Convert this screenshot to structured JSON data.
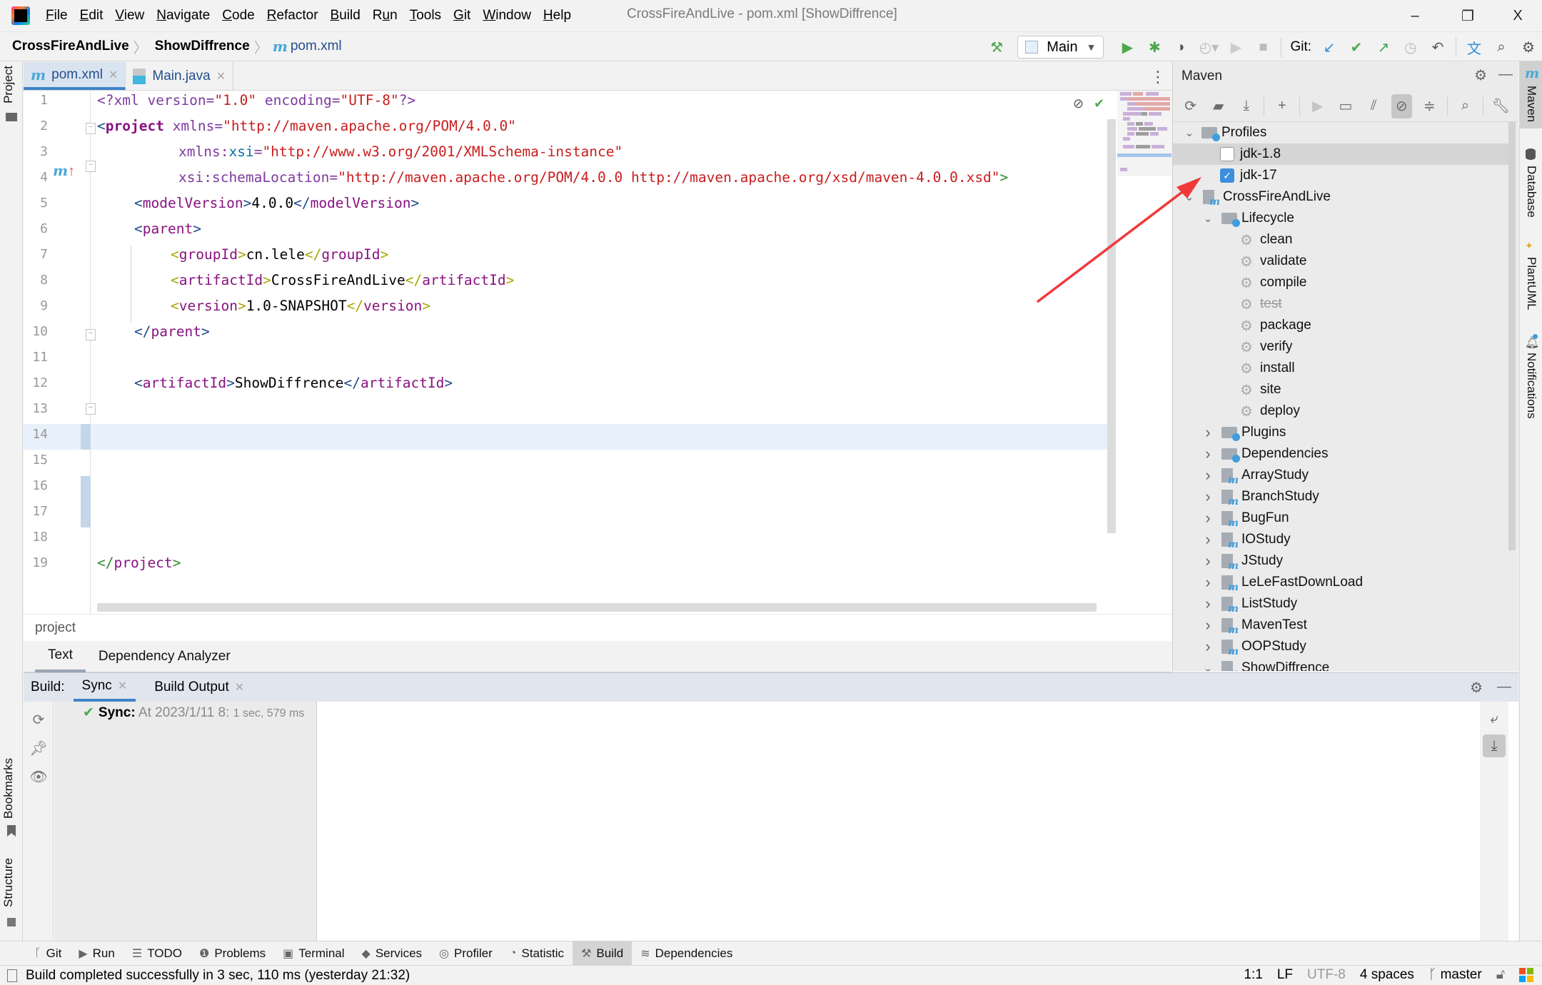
{
  "window": {
    "title": "CrossFireAndLive - pom.xml [ShowDiffrence]",
    "minimize_glyph": "–",
    "restore_glyph": "❐",
    "close_glyph": "X"
  },
  "menu": [
    {
      "mnemonic": "F",
      "rest": "ile"
    },
    {
      "mnemonic": "E",
      "rest": "dit"
    },
    {
      "mnemonic": "V",
      "rest": "iew"
    },
    {
      "mnemonic": "N",
      "rest": "avigate"
    },
    {
      "mnemonic": "C",
      "rest": "ode"
    },
    {
      "mnemonic": "R",
      "rest": "efactor"
    },
    {
      "mnemonic": "B",
      "rest": "uild"
    },
    {
      "pre": "R",
      "mnemonic": "u",
      "rest": "n"
    },
    {
      "mnemonic": "T",
      "rest": "ools"
    },
    {
      "mnemonic": "G",
      "rest": "it"
    },
    {
      "mnemonic": "W",
      "rest": "indow"
    },
    {
      "mnemonic": "H",
      "rest": "elp"
    }
  ],
  "breadcrumb": {
    "project": "CrossFireAndLive",
    "module": "ShowDiffrence",
    "file_icon": "m",
    "file": "pom.xml"
  },
  "toolbar": {
    "run_config": "Main",
    "git_label": "Git:"
  },
  "left_stripe": {
    "project": "Project",
    "bookmarks": "Bookmarks",
    "structure": "Structure"
  },
  "right_stripe": {
    "maven": "Maven",
    "database": "Database",
    "plantuml": "PlantUML",
    "notifications": "Notifications"
  },
  "editor_tabs": [
    {
      "icon": "m",
      "label": "pom.xml",
      "active": true
    },
    {
      "icon": "java",
      "label": "Main.java",
      "active": false
    }
  ],
  "editor": {
    "line_numbers": [
      "1",
      "2",
      "3",
      "4",
      "5",
      "6",
      "7",
      "8",
      "9",
      "10",
      "11",
      "12",
      "13",
      "14",
      "15",
      "16",
      "17",
      "18",
      "19"
    ],
    "lines": {
      "l1": {
        "a": "<?xml ",
        "b": "version",
        "c": "=",
        "d": "\"1.0\"",
        "e": " ",
        "f": "encoding",
        "g": "=",
        "h": "\"UTF-8\"",
        "i": "?>"
      },
      "l2": {
        "a": "<",
        "b": "project",
        "c": " xmlns",
        "d": "=",
        "e": "\"http://maven.apache.org/POM/4.0.0\""
      },
      "l3": {
        "a": "xmlns:",
        "b": "xsi",
        "c": "=",
        "d": "\"http://www.w3.org/2001/XMLSchema-instance\""
      },
      "l4": {
        "a": "xsi:schemaLocation",
        "b": "=",
        "c": "\"http://maven.apache.org/POM/4.0.0 http://maven.apache.org/xsd/maven-4.0.0.xsd\"",
        "d": ">"
      },
      "l5": {
        "a": "<",
        "b": "modelVersion",
        "c": ">",
        "d": "4.0.0",
        "e": "</",
        "f": "modelVersion",
        "g": ">"
      },
      "l6": {
        "a": "<",
        "b": "parent",
        "c": ">"
      },
      "l7": {
        "a": "<",
        "b": "groupId",
        "c": ">",
        "d": "cn.lele",
        "e": "</",
        "f": "groupId",
        "g": ">"
      },
      "l8": {
        "a": "<",
        "b": "artifactId",
        "c": ">",
        "d": "CrossFireAndLive",
        "e": "</",
        "f": "artifactId",
        "g": ">"
      },
      "l9": {
        "a": "<",
        "b": "version",
        "c": ">",
        "d": "1.0-SNAPSHOT",
        "e": "</",
        "f": "version",
        "g": ">"
      },
      "l10": {
        "a": "</",
        "b": "parent",
        "c": ">"
      },
      "l12": {
        "a": "<",
        "b": "artifactId",
        "c": ">",
        "d": "ShowDiffrence",
        "e": "</",
        "f": "artifactId",
        "g": ">"
      },
      "l19": {
        "a": "</",
        "b": "project",
        "c": ">"
      }
    },
    "gutter_marker_line6": "m",
    "current_line": 14
  },
  "structure_path": "project",
  "bottom_editor_tabs": [
    {
      "label": "Text",
      "active": true
    },
    {
      "label": "Dependency Analyzer",
      "active": false
    }
  ],
  "maven": {
    "title": "Maven",
    "tree": [
      {
        "label": "Profiles",
        "level": 0,
        "type": "profiles-folder",
        "expanded": true
      },
      {
        "label": "jdk-1.8",
        "level": 1,
        "type": "checkbox",
        "checked": false,
        "selected": true
      },
      {
        "label": "jdk-17",
        "level": 1,
        "type": "checkbox",
        "checked": true
      },
      {
        "label": "CrossFireAndLive",
        "level": 0,
        "type": "module",
        "expanded": true
      },
      {
        "label": "Lifecycle",
        "level": 1,
        "type": "lifecycle-folder",
        "expanded": true
      },
      {
        "label": "clean",
        "level": 2,
        "type": "goal"
      },
      {
        "label": "validate",
        "level": 2,
        "type": "goal"
      },
      {
        "label": "compile",
        "level": 2,
        "type": "goal"
      },
      {
        "label": "test",
        "level": 2,
        "type": "goal",
        "skipped": true
      },
      {
        "label": "package",
        "level": 2,
        "type": "goal"
      },
      {
        "label": "verify",
        "level": 2,
        "type": "goal"
      },
      {
        "label": "install",
        "level": 2,
        "type": "goal"
      },
      {
        "label": "site",
        "level": 2,
        "type": "goal"
      },
      {
        "label": "deploy",
        "level": 2,
        "type": "goal"
      },
      {
        "label": "Plugins",
        "level": 1,
        "type": "plugins-folder",
        "expanded": false
      },
      {
        "label": "Dependencies",
        "level": 1,
        "type": "dependencies-folder",
        "expanded": false
      },
      {
        "label": "ArrayStudy",
        "level": 1,
        "type": "module",
        "expanded": false
      },
      {
        "label": "BranchStudy",
        "level": 1,
        "type": "module",
        "expanded": false
      },
      {
        "label": "BugFun",
        "level": 1,
        "type": "module",
        "expanded": false
      },
      {
        "label": "IOStudy",
        "level": 1,
        "type": "module",
        "expanded": false
      },
      {
        "label": "JStudy",
        "level": 1,
        "type": "module",
        "expanded": false
      },
      {
        "label": "LeLeFastDownLoad",
        "level": 1,
        "type": "module",
        "expanded": false
      },
      {
        "label": "ListStudy",
        "level": 1,
        "type": "module",
        "expanded": false
      },
      {
        "label": "MavenTest",
        "level": 1,
        "type": "module",
        "expanded": false
      },
      {
        "label": "OOPStudy",
        "level": 1,
        "type": "module",
        "expanded": false
      },
      {
        "label": "ShowDiffrence",
        "level": 1,
        "type": "module",
        "expanded": true
      }
    ]
  },
  "build": {
    "label": "Build:",
    "tabs": [
      {
        "label": "Sync",
        "active": true
      },
      {
        "label": "Build Output",
        "active": false
      }
    ],
    "sync_result": {
      "label": "Sync:",
      "when": "At 2023/1/11 8:",
      "duration": "1 sec, 579 ms"
    }
  },
  "tool_stripe": [
    {
      "icon": "git-branch-icon",
      "glyph": "ᚴ",
      "label": "Git"
    },
    {
      "icon": "run-icon",
      "glyph": "▶",
      "label": "Run"
    },
    {
      "icon": "todo-icon",
      "glyph": "☰",
      "label": "TODO"
    },
    {
      "icon": "problems-icon",
      "glyph": "❶",
      "label": "Problems"
    },
    {
      "icon": "terminal-icon",
      "glyph": "▣",
      "label": "Terminal"
    },
    {
      "icon": "services-icon",
      "glyph": "◆",
      "label": "Services"
    },
    {
      "icon": "profiler-icon",
      "glyph": "◎",
      "label": "Profiler"
    },
    {
      "icon": "statistic-icon",
      "glyph": "◔",
      "label": "Statistic"
    },
    {
      "icon": "build-hammer-icon",
      "glyph": "⚒",
      "label": "Build",
      "active": true
    },
    {
      "icon": "dependencies-icon",
      "glyph": "≋",
      "label": "Dependencies"
    }
  ],
  "status": {
    "message": "Build completed successfully in 3 sec, 110 ms (yesterday 21:32)",
    "caret": "1:1",
    "line_sep": "LF",
    "encoding": "UTF-8",
    "indent": "4 spaces",
    "branch": "master"
  },
  "colors": {
    "accent": "#4083c9",
    "success": "#4fa84f",
    "annotation_arrow": "#f03a3a",
    "maven_blue": "#3d9ee0"
  }
}
